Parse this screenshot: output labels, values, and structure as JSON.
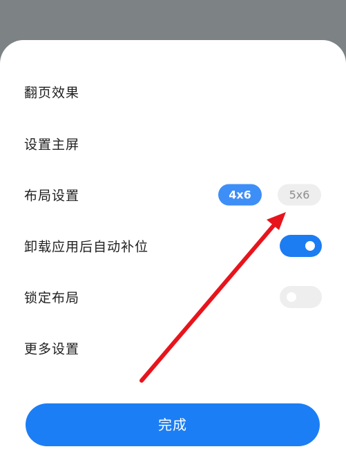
{
  "settings": {
    "page_turn_effect": "翻页效果",
    "set_home_screen": "设置主屏",
    "layout_settings": "布局设置",
    "layout_options": [
      "4x6",
      "5x6"
    ],
    "layout_selected": "4x6",
    "auto_fill_after_uninstall": "卸载应用后自动补位",
    "auto_fill_enabled": true,
    "lock_layout": "锁定布局",
    "lock_layout_enabled": false,
    "more_settings": "更多设置"
  },
  "footer": {
    "done_label": "完成"
  },
  "colors": {
    "accent": "#1c7ef4",
    "chip_active": "#3e8ef7",
    "annotation_arrow": "#e8141c",
    "backdrop": "#7d8384"
  }
}
